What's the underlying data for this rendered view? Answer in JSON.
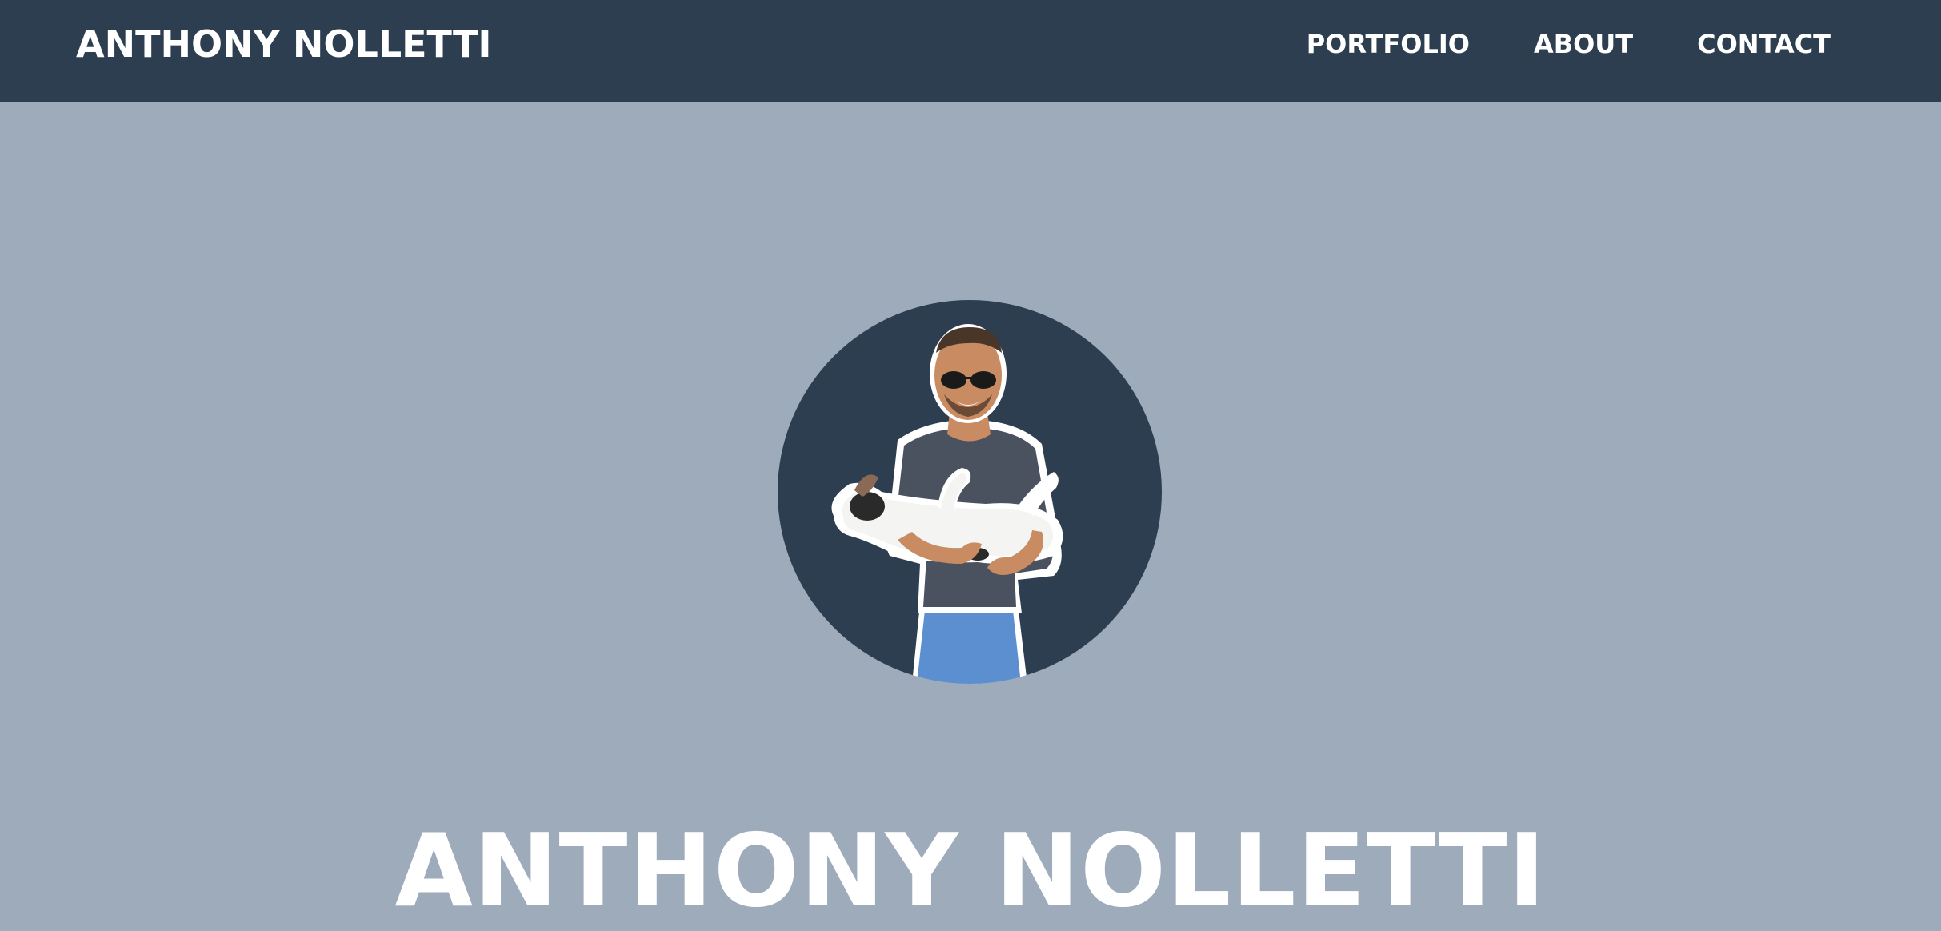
{
  "navbar": {
    "brand": "ANTHONY NOLLETTI",
    "links": [
      {
        "label": "PORTFOLIO"
      },
      {
        "label": "ABOUT"
      },
      {
        "label": "CONTACT"
      }
    ],
    "background": "#2c3e50"
  },
  "hero": {
    "title": "ANTHONY NOLLETTI",
    "avatar_icon": "avatar-photo",
    "background": "#9eabbb"
  },
  "colors": {
    "text": "#ffffff",
    "avatar_circle": "#2c3e50"
  }
}
